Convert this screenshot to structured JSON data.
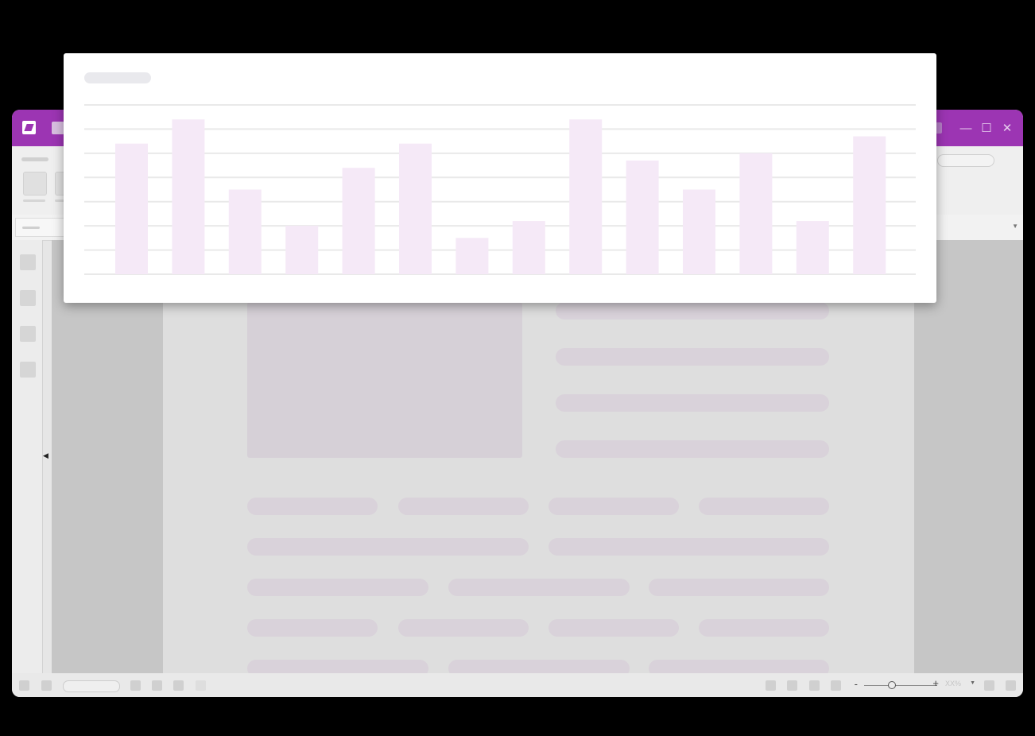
{
  "colors": {
    "accent": "#9c35b3",
    "bar_fill": "#f5e9f7",
    "grid": "#e9e9e9",
    "placeholder": "#d9d2da"
  },
  "icons": {
    "app_logo": "app-logo-icon",
    "minimize": "minimize-icon",
    "maximize": "maximize-icon",
    "close": "close-icon",
    "collapse": "chevron-left-icon",
    "zoom_out": "minus-icon",
    "zoom_in": "plus-icon",
    "dropdown": "chevron-down-icon"
  },
  "window_controls": {
    "minimize_glyph": "—",
    "maximize_glyph": "☐",
    "close_glyph": "✕"
  },
  "statusbar": {
    "zoom_minus": "-",
    "zoom_plus": "+",
    "zoom_value": "XX%",
    "zoom_level": 0.48
  },
  "chart_data": {
    "type": "bar",
    "title": "",
    "xlabel": "",
    "ylabel": "",
    "categories": [
      "",
      "",
      "",
      "",
      "",
      "",
      "",
      "",
      "",
      "",
      "",
      "",
      "",
      ""
    ],
    "values": [
      5.4,
      6.4,
      3.5,
      2.0,
      4.4,
      5.4,
      1.5,
      2.2,
      6.4,
      4.7,
      3.5,
      5.0,
      2.2,
      5.7
    ],
    "ylim": [
      0,
      7
    ],
    "grid": true,
    "legend": "none"
  }
}
